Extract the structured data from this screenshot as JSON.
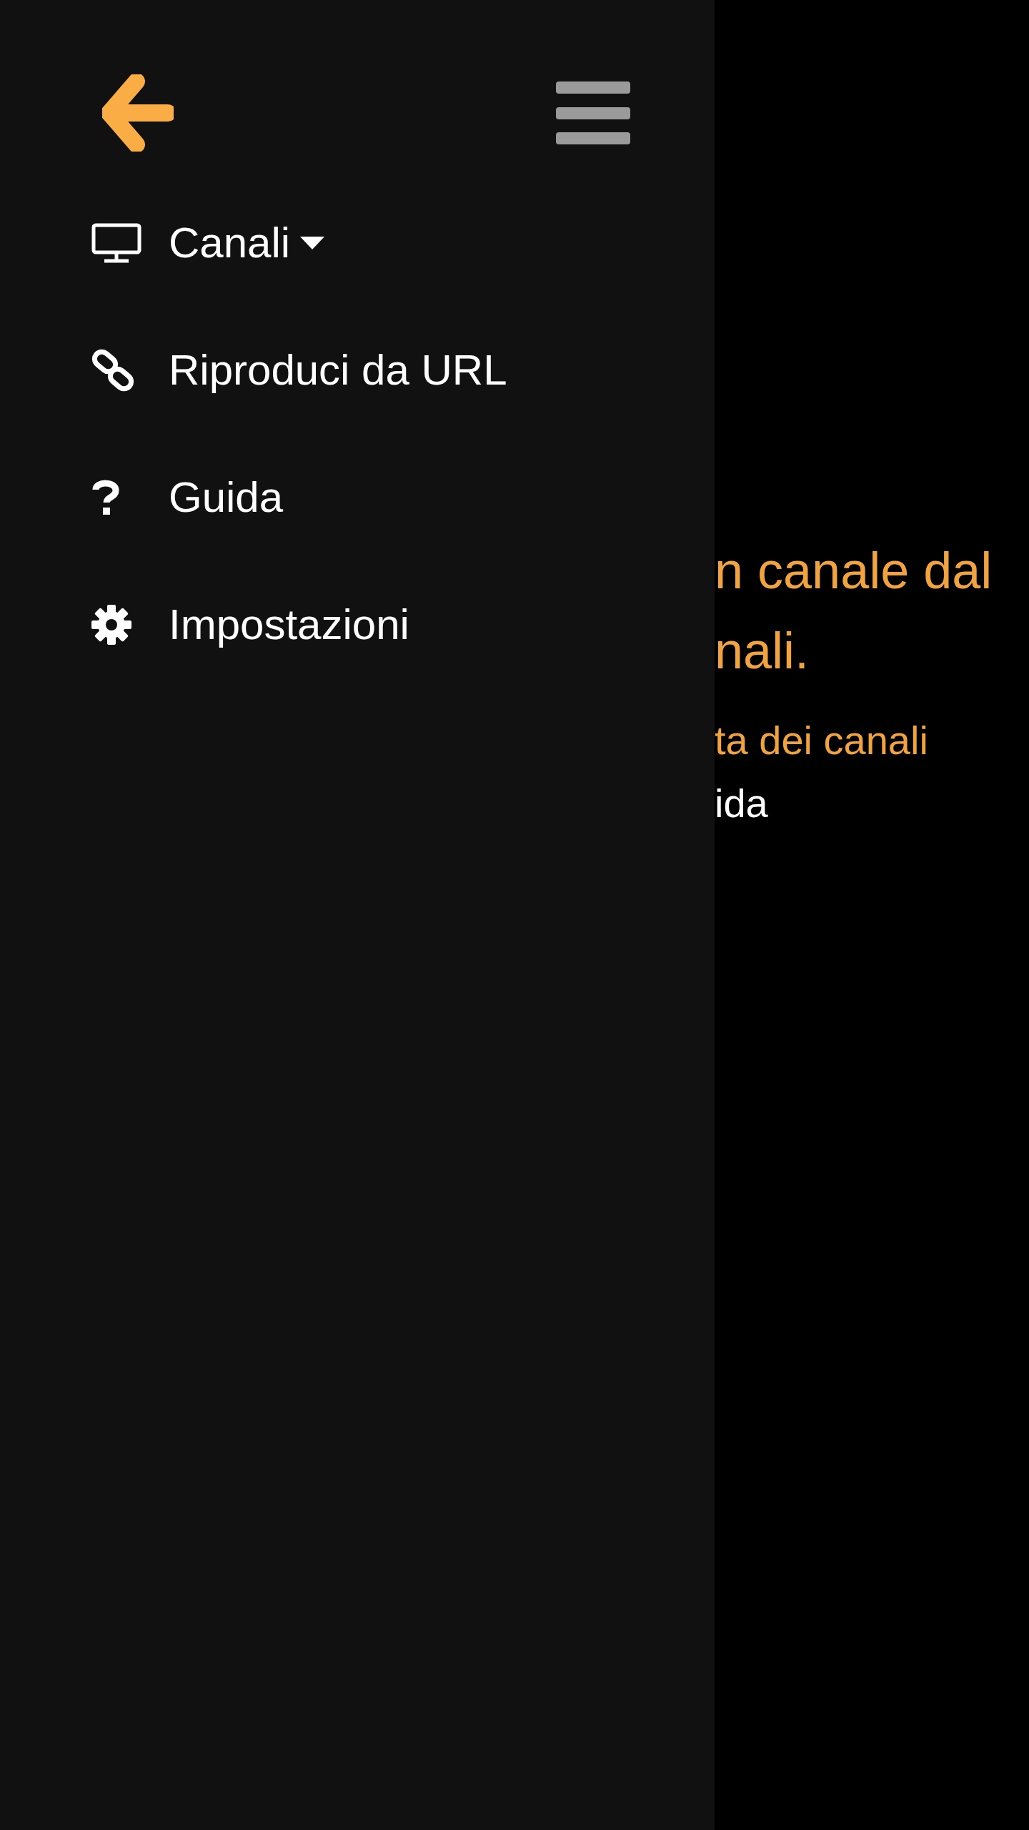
{
  "menu": [
    {
      "kind": "dropdown",
      "label": "Canali"
    },
    {
      "kind": "link",
      "label": "Riproduci da URL"
    },
    {
      "kind": "link",
      "label": "Guida"
    },
    {
      "kind": "link",
      "label": "Impostazioni"
    }
  ],
  "content": {
    "message_lines": [
      "n canale dal",
      "nali."
    ],
    "links": [
      {
        "kind": "accent",
        "text": "ta dei canali"
      },
      {
        "kind": "plain",
        "text": "ida"
      }
    ]
  }
}
